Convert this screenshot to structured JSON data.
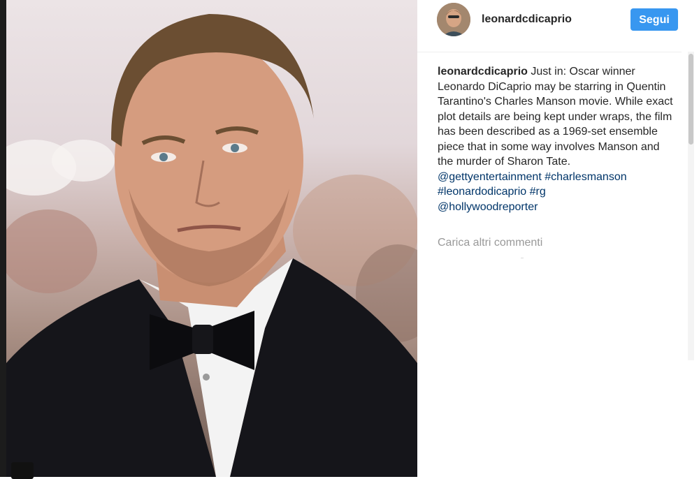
{
  "post": {
    "username": "leonardcdicaprio",
    "follow_label": "Segui",
    "caption_user": "leonardcdicaprio",
    "caption_text": " Just in: Oscar winner Leonardo DiCaprio may be starring in Quentin Tarantino's Charles Manson movie. While exact plot details are being kept under wraps, the film has been described as a 1969-set ensemble piece that in some way involves Manson and the murder of Sharon Tate.",
    "tags": [
      "@gettyentertainment #charlesmanson",
      "#leonardodicaprio #rg",
      "@hollywoodreporter"
    ],
    "load_more_label": "Carica altri commenti"
  },
  "icons": {
    "user_tag": "user-tag-icon"
  },
  "colors": {
    "follow_button": "#3897f0",
    "hashtag": "#003569",
    "muted": "#999999"
  }
}
